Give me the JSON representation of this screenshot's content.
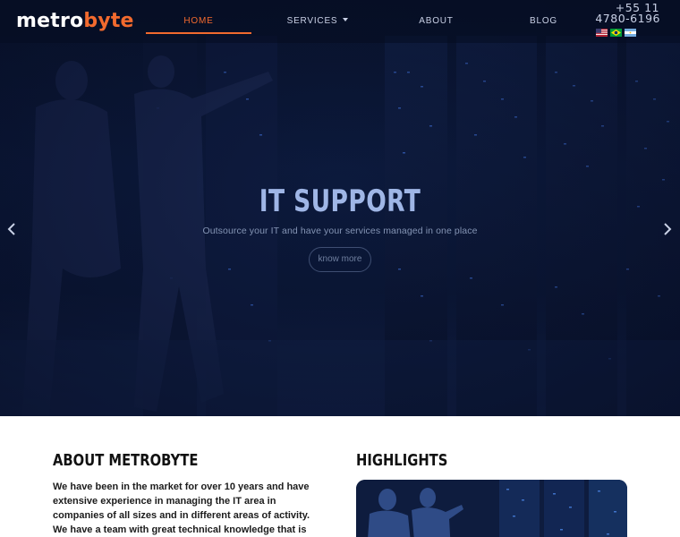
{
  "brand": {
    "part1": "metro",
    "part2": "byte"
  },
  "nav": {
    "home": "HOME",
    "services": "SERVICES",
    "about": "ABOUT",
    "blog": "BLOG",
    "phone_line1": "+55 11",
    "phone_line2": "4780-6196"
  },
  "flags": [
    {
      "name": "us-flag-icon"
    },
    {
      "name": "brazil-flag-icon"
    },
    {
      "name": "argentina-flag-icon"
    }
  ],
  "hero": {
    "title": "IT SUPPORT",
    "subtitle": "Outsource your IT and have your services managed in one place",
    "button": "know more"
  },
  "about": {
    "title": "ABOUT METROBYTE",
    "text": "We have been in the market for over 10 years and have extensive experience in managing the IT area in companies of all sizes and in different areas of activity. We have a team with great technical knowledge that is always looking for new learning to offer the best"
  },
  "highlights": {
    "title": "HIGHLIGHTS"
  },
  "colors": {
    "accent": "#f26a2e",
    "hero_bg": "#0c1a3d",
    "hero_title": "#9fb6e6"
  }
}
